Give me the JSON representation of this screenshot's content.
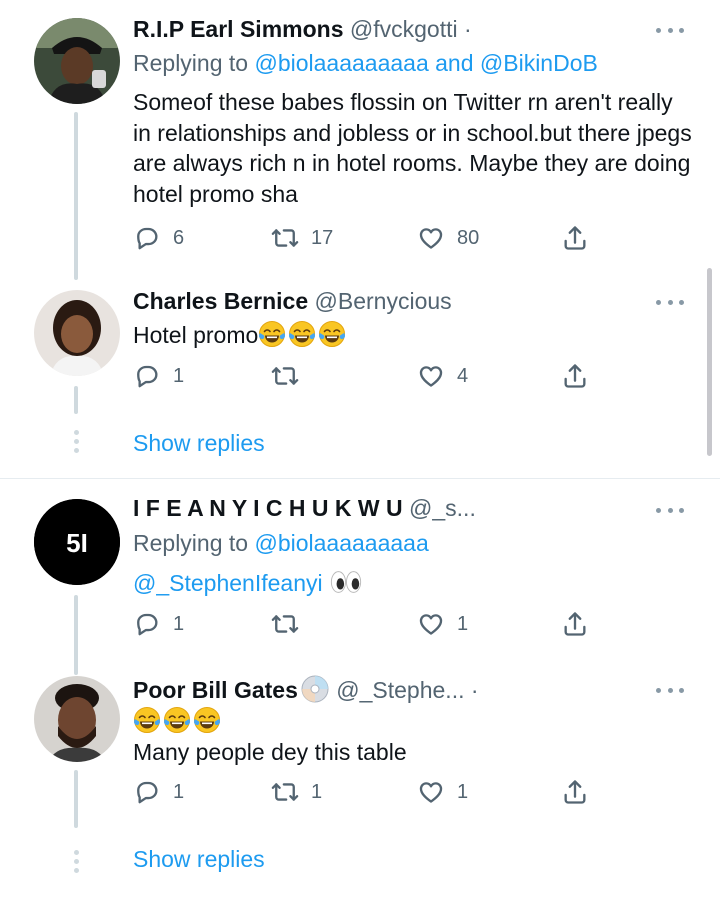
{
  "tweets": [
    {
      "name": "R.I.P Earl Simmons",
      "handle": "@fvckgotti",
      "separator": "·",
      "replying_prefix": "Replying to ",
      "replying_mentions": "@biolaaaaaaaaa and @BikinDoB",
      "text": "Someof these babes flossin on Twitter rn aren't really in relationships and jobless or in school.but there jpegs are always rich n in hotel rooms. Maybe they are doing hotel promo sha",
      "replies": "6",
      "retweets": "17",
      "likes": "80"
    },
    {
      "name": "Charles Bernice",
      "handle": "@Bernycious",
      "text": "Hotel promo",
      "emoji": "face-with-tears-of-joy x3",
      "replies": "1",
      "retweets": "",
      "likes": "4",
      "show_replies": "Show replies"
    },
    {
      "name": "I F E A N Y I C H U K W U",
      "handle": "@_s...",
      "avatar_text": "5I",
      "replying_prefix": "Replying to ",
      "replying_mentions": "@biolaaaaaaaaa",
      "text_mention": "@_StephenIfeanyi",
      "emoji": "eyes",
      "replies": "1",
      "retweets": "",
      "likes": "1"
    },
    {
      "name": "Poor Bill Gates",
      "handle": "@_Stephe...",
      "separator": "·",
      "badge_icon": "cd-icon",
      "emoji": "face-with-tears-of-joy x3",
      "text": "Many people dey this table",
      "replies": "1",
      "retweets": "1",
      "likes": "1",
      "show_replies": "Show replies"
    }
  ],
  "colors": {
    "link": "#1d9bf0",
    "secondary": "#536471",
    "line": "#cfd9de"
  }
}
